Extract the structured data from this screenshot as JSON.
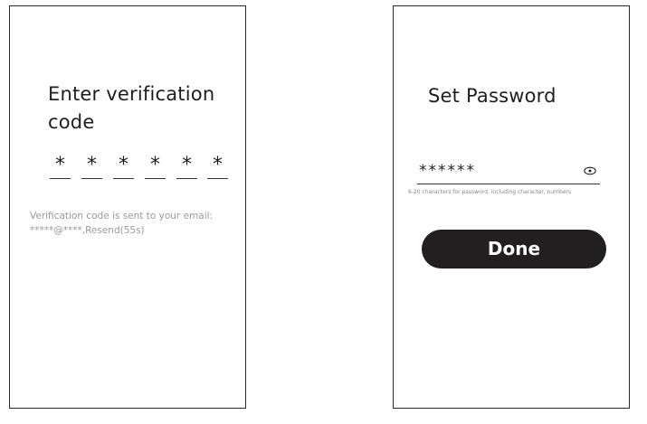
{
  "verify_screen": {
    "title_line1": "Enter verification",
    "title_line2": "code",
    "code_digits": [
      "*",
      "*",
      "*",
      "*",
      "*",
      "*"
    ],
    "hint_line1": "Verification code is sent to your email:",
    "hint_line2": "*****@****,Resend(55s)"
  },
  "password_screen": {
    "title": "Set Password",
    "password_value": "******",
    "visibility_icon": "eye-icon",
    "hint": "6-20 characters for password, including character, numbers",
    "done_label": "Done"
  },
  "colors": {
    "text": "#1e1e1e",
    "hint_text": "#9a9a9a",
    "button_bg": "#231f20",
    "button_text": "#ffffff",
    "frame_border": "#2a2a2a"
  }
}
